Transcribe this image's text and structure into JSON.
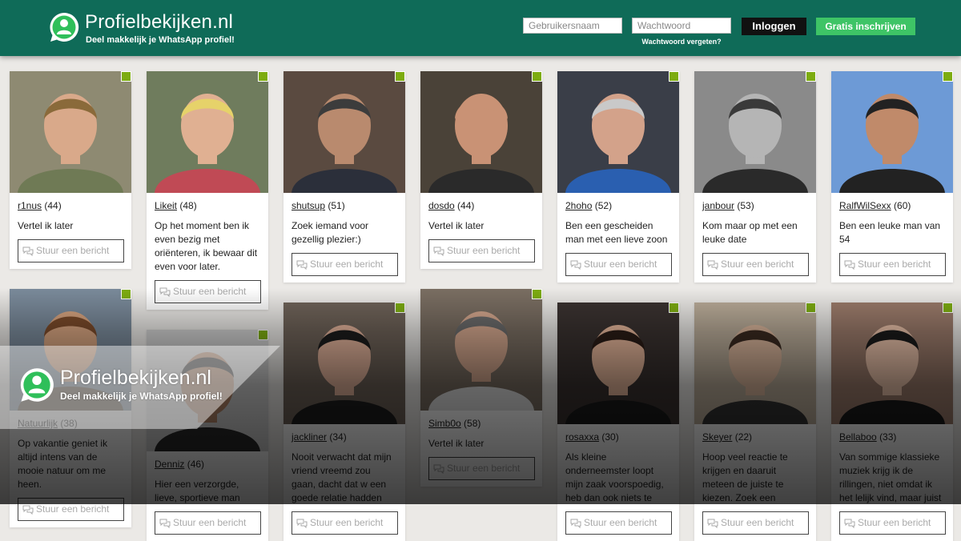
{
  "header": {
    "logo_title": "Profielbekijken.nl",
    "logo_subtitle": "Deel makkelijk je WhatsApp profiel!",
    "logo_icon": "whatsapp-person-icon",
    "username_placeholder": "Gebruikersnaam",
    "password_placeholder": "Wachtwoord",
    "login_label": "Inloggen",
    "signup_label": "Gratis inschrijven",
    "forgot_label": "Wachtwoord vergeten?"
  },
  "message_button_label": "Stuur een bericht",
  "message_icon": "speech-bubbles-icon",
  "profiles": [
    {
      "name": "r1nus",
      "age": "(44)",
      "text": "Vertel ik later"
    },
    {
      "name": "Likeit",
      "age": "(48)",
      "text": "Op het moment ben ik even bezig met oriënteren, ik bewaar dit even voor later."
    },
    {
      "name": "shutsup",
      "age": "(51)",
      "text": "Zoek iemand voor gezellig plezier:)"
    },
    {
      "name": "dosdo",
      "age": "(44)",
      "text": "Vertel ik later"
    },
    {
      "name": "2hoho",
      "age": "(52)",
      "text": "Ben een gescheiden man met een lieve zoon"
    },
    {
      "name": "janbour",
      "age": "(53)",
      "text": "Kom maar op met een leuke date"
    },
    {
      "name": "RalfWilSexx",
      "age": "(60)",
      "text": "Ben een leuke man van 54"
    },
    {
      "name": "Natuurlijk",
      "age": "(38)",
      "text": "Op vakantie geniet ik altijd intens van de mooie natuur om me heen."
    },
    {
      "name": "Denniz",
      "age": "(46)",
      "text": "Hier een verzorgde, lieve, sportieve man"
    },
    {
      "name": "jackliner",
      "age": "(34)",
      "text": "Nooit verwacht dat mijn vriend vreemd zou gaan, dacht dat w een goede relatie hadden"
    },
    {
      "name": "Simb0o",
      "age": "(58)",
      "text": "Vertel ik later"
    },
    {
      "name": "rosaxxa",
      "age": "(30)",
      "text": "Als kleine onderneemster loopt mijn zaak voorspoedig, heb dan ook niets te"
    },
    {
      "name": "Skeyer",
      "age": "(22)",
      "text": "Hoop veel reactie te krijgen en daaruit meteen de juiste te kiezen. Zoek een"
    },
    {
      "name": "Bellaboo",
      "age": "(33)",
      "text": "Van sommige klassieke muziek krijg ik de rillingen, niet omdat ik het lelijk vind, maar juist"
    }
  ],
  "overlay": {
    "title": "Profielbekijken.nl",
    "subtitle": "Deel makkelijk je WhatsApp profiel!"
  },
  "colors": {
    "header_bg": "#0f6b58",
    "signup_green": "#3ec466",
    "online_indicator": "#7dac10"
  }
}
